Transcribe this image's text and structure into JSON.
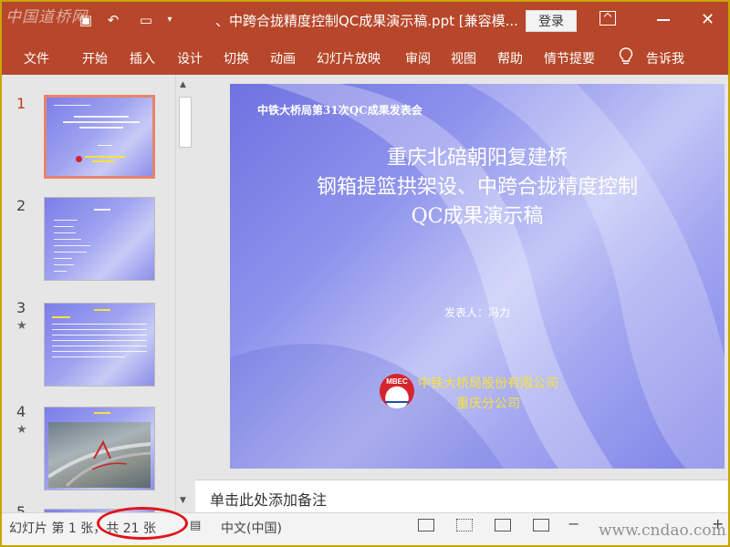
{
  "app": {
    "watermark_logo": "中国道桥网",
    "window_title": "、中跨合拢精度控制QC成果演示稿.ppt [兼容模...",
    "login_label": "登录",
    "close_glyph": "✕"
  },
  "ribbon": {
    "tabs": [
      "文件",
      "开始",
      "插入",
      "设计",
      "切换",
      "动画",
      "幻灯片放映",
      "审阅",
      "视图",
      "帮助",
      "情节提要"
    ],
    "tell_me": "告诉我"
  },
  "thumbnails": [
    {
      "number": "1",
      "active": true,
      "star": ""
    },
    {
      "number": "2",
      "active": false,
      "star": ""
    },
    {
      "number": "3",
      "active": false,
      "star": "★"
    },
    {
      "number": "4",
      "active": false,
      "star": "★"
    },
    {
      "number": "5",
      "active": false,
      "star": ""
    }
  ],
  "slide": {
    "conference_title": "中铁大桥局第31次QC成果发表会",
    "title_lines": [
      "重庆北碚朝阳复建桥",
      "钢箱提篮拱架设、中跨合拢精度控制",
      "QC成果演示稿"
    ],
    "presenter": "发表人：冯力",
    "logo_text": "MBEC",
    "company_lines": [
      "中铁大桥局股份有限公司",
      "重庆分公司"
    ]
  },
  "notes": {
    "placeholder": "单击此处添加备注"
  },
  "status": {
    "slide_info": "幻灯片 第 1 张，共 21 张",
    "language": "中文(中国)",
    "site_watermark": "www.cndao.com",
    "zoom_minus": "−",
    "zoom_plus": "+"
  },
  "colors": {
    "accent": "#b7472a",
    "highlight": "#e0141b",
    "slide_title_color": "#ffffff",
    "company_color": "#f7e23a"
  }
}
